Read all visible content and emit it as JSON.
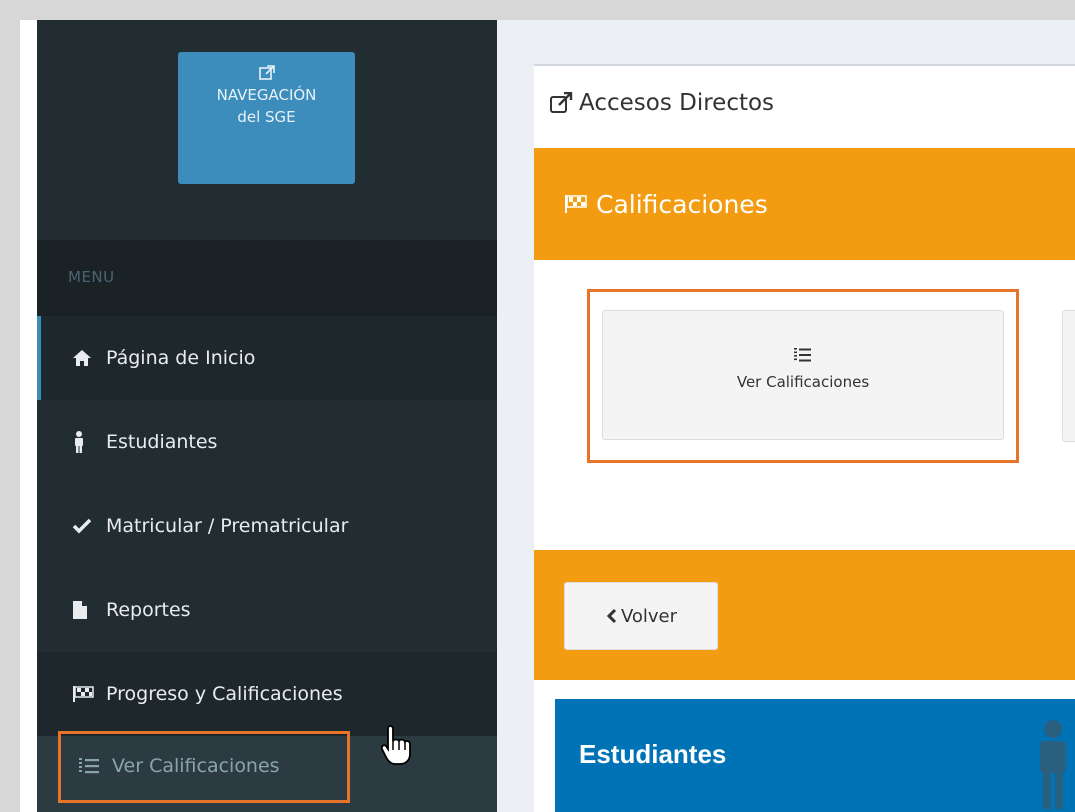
{
  "sidebar": {
    "nav_button": {
      "line1": "NAVEGACIÓN",
      "line2": "del SGE",
      "icon": "external-link-icon"
    },
    "menu_header": "MENU",
    "items": [
      {
        "label": "Página de Inicio",
        "icon": "home-icon"
      },
      {
        "label": "Estudiantes",
        "icon": "male-icon"
      },
      {
        "label": "Matricular / Prematricular",
        "icon": "check-icon"
      },
      {
        "label": "Reportes",
        "icon": "file-icon"
      },
      {
        "label": "Progreso y Calificaciones",
        "icon": "checkered-flag-icon"
      }
    ],
    "submenu": [
      {
        "label": "Ver Calificaciones",
        "icon": "list-ol-icon"
      }
    ]
  },
  "main": {
    "card_title": "Accesos Directos",
    "section_title": "Calificaciones",
    "shortcut_button": "Ver Calificaciones",
    "back_button": "Volver",
    "info_box_title": "Estudiantes"
  },
  "colors": {
    "sidebar": "#222d32",
    "primary": "#3c8dbc",
    "warning": "#f39c12",
    "info_box": "#0073b7",
    "highlight": "#e8742a"
  }
}
